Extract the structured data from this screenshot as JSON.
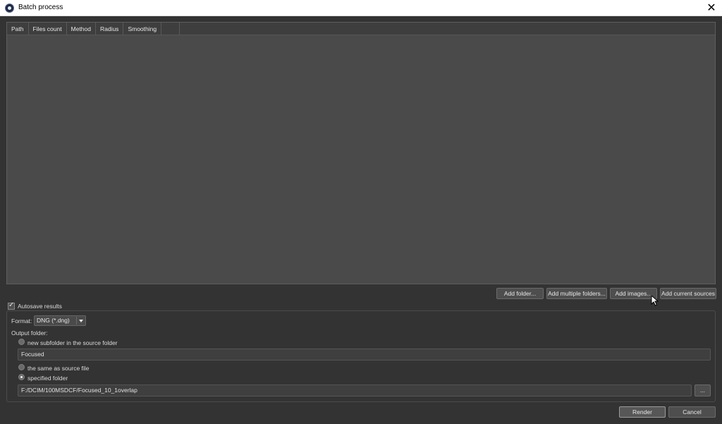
{
  "window": {
    "title": "Batch process",
    "close_glyph": "✕"
  },
  "table": {
    "columns": [
      "Path",
      "Files count",
      "Method",
      "Radius",
      "Smoothing"
    ]
  },
  "add_buttons": {
    "add_folder": "Add folder...",
    "add_multiple_folders": "Add multiple folders...",
    "add_images": "Add images...",
    "add_current_sources": "Add current sources"
  },
  "autosave": {
    "label": "Autosave results",
    "checked": true
  },
  "output": {
    "format_label": "Format:",
    "format_value": "DNG (*.dng)",
    "folder_label": "Output folder:",
    "options": {
      "subfolder": "new subfolder in the source folder",
      "same_as_source": "the same as source file",
      "specified": "specified folder"
    },
    "selected_option": "specified folder",
    "subfolder_name": "Focused",
    "specified_path": "F:/DCIM/100MSDCF/Focused_10_1overlap",
    "browse_label": "..."
  },
  "footer": {
    "render": "Render",
    "cancel": "Cancel"
  },
  "colors": {
    "background": "#333333",
    "table_body": "#4a4a4a",
    "title_bar": "#ffffff"
  },
  "icons": [
    "app-icon",
    "close-icon",
    "dropdown-caret-icon",
    "mouse-pointer-icon"
  ]
}
